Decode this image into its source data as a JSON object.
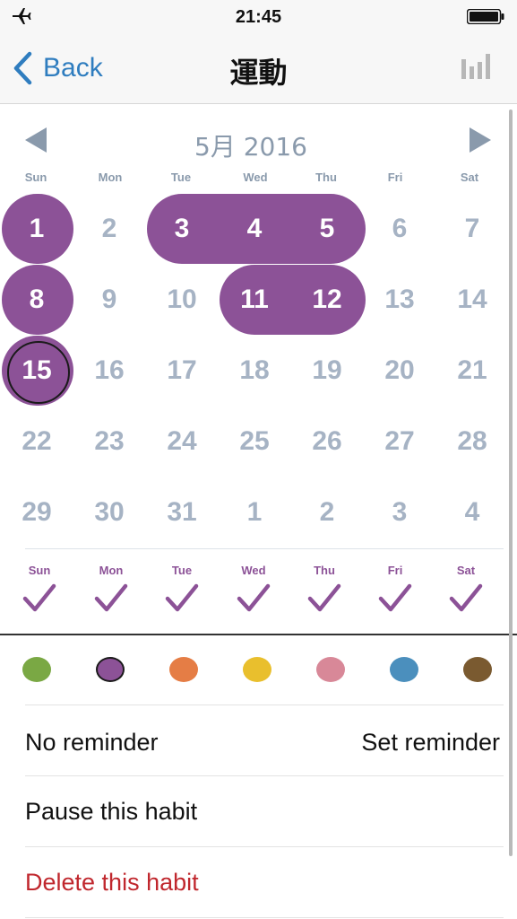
{
  "status_bar": {
    "time": "21:45",
    "airplane_icon": "airplane-icon",
    "battery_icon": "battery-icon"
  },
  "nav": {
    "back_label": "Back",
    "title": "運動",
    "stats_icon": "bar-chart-icon"
  },
  "calendar": {
    "month_label": "5月 2016",
    "weekdays": [
      "Sun",
      "Mon",
      "Tue",
      "Wed",
      "Thu",
      "Fri",
      "Sat"
    ],
    "weeks": [
      [
        "1",
        "2",
        "3",
        "4",
        "5",
        "6",
        "7"
      ],
      [
        "8",
        "9",
        "10",
        "11",
        "12",
        "13",
        "14"
      ],
      [
        "15",
        "16",
        "17",
        "18",
        "19",
        "20",
        "21"
      ],
      [
        "22",
        "23",
        "24",
        "25",
        "26",
        "27",
        "28"
      ],
      [
        "29",
        "30",
        "31",
        "1",
        "2",
        "3",
        "4"
      ]
    ],
    "completed_days": [
      "1",
      "3",
      "4",
      "5",
      "8",
      "11",
      "12",
      "15"
    ],
    "today": "15"
  },
  "schedule": {
    "days": [
      "Sun",
      "Mon",
      "Tue",
      "Wed",
      "Thu",
      "Fri",
      "Sat"
    ],
    "checked": [
      true,
      true,
      true,
      true,
      true,
      true,
      true
    ]
  },
  "colors": {
    "swatches": [
      "#7aa844",
      "#8c5297",
      "#e57d45",
      "#e9bf2d",
      "#d88898",
      "#4b8fbd",
      "#7a5a30"
    ],
    "selected_index": 1,
    "accent": "#8c5297"
  },
  "reminder": {
    "label": "No reminder",
    "action": "Set reminder"
  },
  "actions": {
    "pause": "Pause this habit",
    "delete": "Delete this habit"
  }
}
